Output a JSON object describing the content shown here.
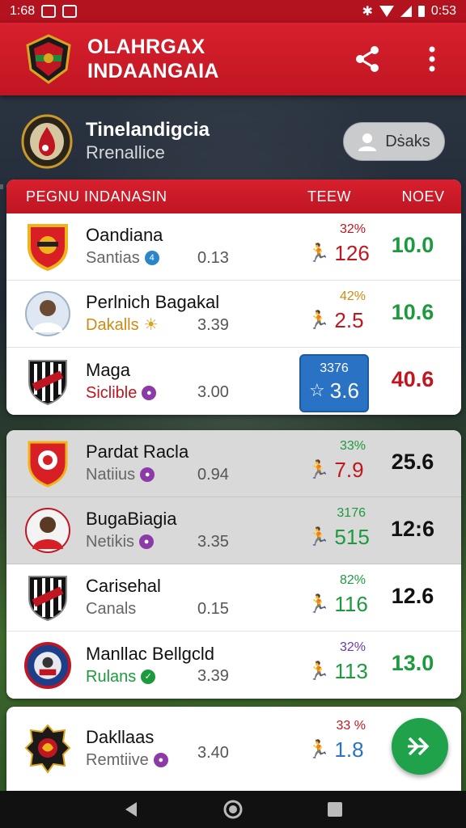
{
  "status_bar": {
    "time": "1:68",
    "clock_right": "0:53"
  },
  "app_bar": {
    "title_line1": "OLAHRGAX",
    "title_line2": "INDAANGAIA",
    "share_icon": "share-icon",
    "menu_icon": "more-vert-icon"
  },
  "team": {
    "name": "Tinelandigcia",
    "subtitle": "Rrenallice",
    "details_label": "Dṡaks"
  },
  "table": {
    "headers": {
      "player": "PEGNU INDANASIN",
      "teew": "TEEW",
      "noev": "NOEV"
    },
    "rows": [
      {
        "name": "Oandiana",
        "sub": "Santias",
        "rating": "0.13",
        "pct": "32%",
        "stat": "126",
        "score": "10.0"
      },
      {
        "name": "Perlnich Bagakal",
        "sub": "Dakalls",
        "rating": "3.39",
        "pct": "42%",
        "stat": "2.5",
        "score": "10.6"
      },
      {
        "name": "Maga",
        "sub": "Siclible",
        "rating": "3.00",
        "pct": "3376",
        "stat": "3.6",
        "score": "40.6"
      },
      {
        "name": "Pardat Racla",
        "sub": "Natiius",
        "rating": "0.94",
        "pct": "33%",
        "stat": "7.9",
        "score": "25.6"
      },
      {
        "name": "BugaBiagia",
        "sub": "Netikis",
        "rating": "3.35",
        "pct": "3176",
        "stat": "515",
        "score": "12:6"
      },
      {
        "name": "Carisehal",
        "sub": "Canals",
        "rating": "0.15",
        "pct": "82%",
        "stat": "116",
        "score": "12.6"
      },
      {
        "name": "Manllac Bellgcld",
        "sub": "Rulans",
        "rating": "3.39",
        "pct": "32%",
        "stat": "113",
        "score": "13.0"
      },
      {
        "name": "Dakllaas",
        "sub": "Remtiive",
        "rating": "3.40",
        "pct": "33 %",
        "stat": "1.8",
        "score": ""
      }
    ]
  },
  "colors": {
    "primary": "#d8202e",
    "green": "#1fa24a",
    "blue": "#2a72c4"
  }
}
